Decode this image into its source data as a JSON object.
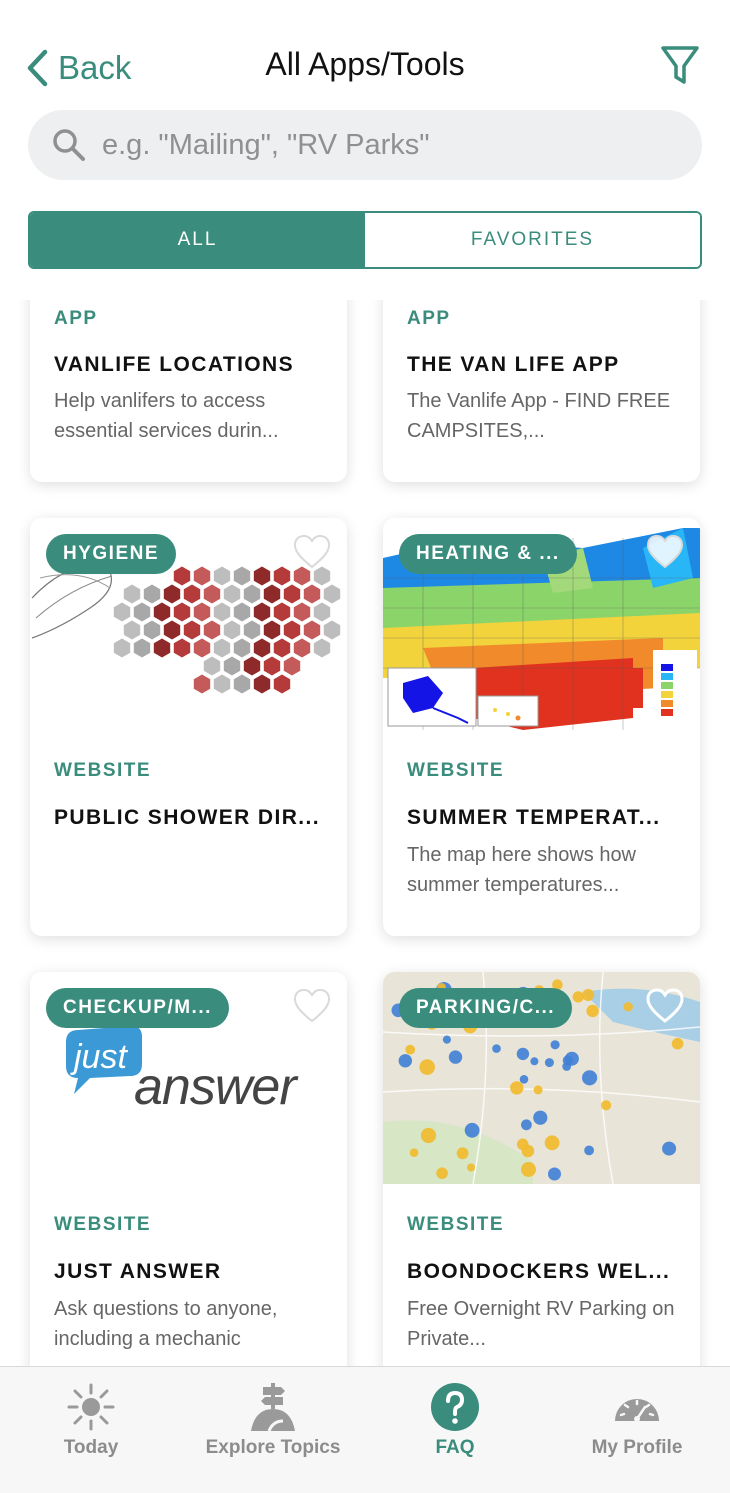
{
  "header": {
    "back_label": "Back",
    "title": "All Apps/Tools",
    "search_placeholder": "e.g. \"Mailing\", \"RV Parks\""
  },
  "segments": {
    "all": "ALL",
    "favorites": "FAVORITES",
    "selected": "ALL"
  },
  "cards": [
    {
      "type": "APP",
      "name": "VANLIFE LOCATIONS",
      "description": "Help vanlifers to access essential services durin...",
      "image": "none"
    },
    {
      "type": "APP",
      "name": "THE VAN LIFE APP",
      "description": "The Vanlife App - FIND FREE CAMPSITES,...",
      "image": "none"
    },
    {
      "category": "HYGIENE",
      "type": "WEBSITE",
      "name": "PUBLIC SHOWER DIR...",
      "description": "",
      "image": "hex-map-icon"
    },
    {
      "category": "HEATING & ...",
      "type": "WEBSITE",
      "name": "SUMMER TEMPERAT...",
      "description": "The map here shows how summer temperatures...",
      "image": "temperature-map-icon"
    },
    {
      "category": "CHECKUP/M...",
      "type": "WEBSITE",
      "name": "JUST ANSWER",
      "description": "Ask questions to anyone, including a mechanic",
      "image": "justanswer-logo",
      "logo": {
        "top": "just",
        "bottom": "answer"
      }
    },
    {
      "category": "PARKING/C...",
      "type": "WEBSITE",
      "name": "BOONDOCKERS WEL...",
      "description": "Free Overnight RV Parking on Private...",
      "image": "parking-map-icon"
    }
  ],
  "tabbar": [
    {
      "label": "Today",
      "icon": "sun-icon",
      "active": false
    },
    {
      "label": "Explore Topics",
      "icon": "signpost-icon",
      "active": false
    },
    {
      "label": "FAQ",
      "icon": "question-icon",
      "active": true
    },
    {
      "label": "My Profile",
      "icon": "gauge-icon",
      "active": false
    }
  ],
  "colors": {
    "accent": "#3a8c7c",
    "text": "#111111",
    "muted": "#666666",
    "tab_inactive": "#8c8c8c"
  }
}
